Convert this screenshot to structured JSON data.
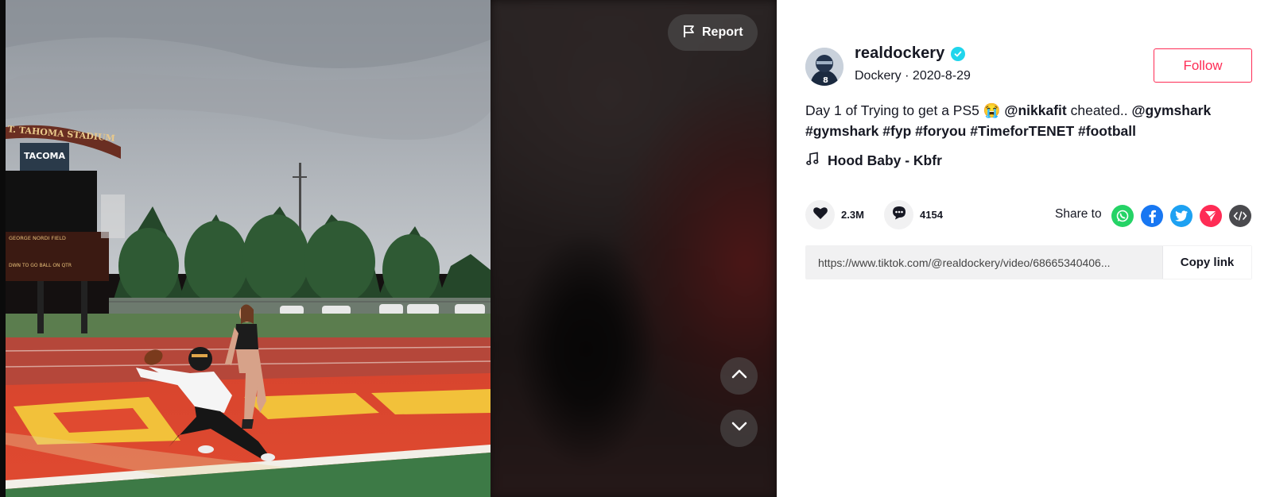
{
  "video": {
    "report_label": "Report",
    "prev_icon": "chevron-up-icon",
    "next_icon": "chevron-down-icon",
    "stadium_sign": "T. TAHOMA STADIUM",
    "scoreboard_logo": "TACOMA",
    "scoreboard_field": "GEORGE NORDI FIELD",
    "scoreboard_row": "DWN  TO GO  BALL ON  QTR"
  },
  "author": {
    "username": "realdockery",
    "verified": true,
    "display_name": "Dockery",
    "separator": "·",
    "date": "2020-8-29",
    "follow_label": "Follow"
  },
  "caption": {
    "parts": [
      {
        "text": "Day 1 of Trying to get a PS5 ",
        "link": false
      },
      {
        "text": "😭",
        "link": false,
        "emoji": true
      },
      {
        "text": " ",
        "link": false
      },
      {
        "text": "@nikkafit",
        "link": true
      },
      {
        "text": " cheated.. ",
        "link": false
      },
      {
        "text": "@gymshark",
        "link": true
      },
      {
        "text": " ",
        "link": false
      },
      {
        "text": "#gymshark",
        "link": true
      },
      {
        "text": " ",
        "link": false
      },
      {
        "text": "#fyp",
        "link": true
      },
      {
        "text": " ",
        "link": false
      },
      {
        "text": "#foryou",
        "link": true
      },
      {
        "text": " ",
        "link": false
      },
      {
        "text": "#TimeforTENET",
        "link": true
      },
      {
        "text": " ",
        "link": false
      },
      {
        "text": "#football",
        "link": true
      }
    ]
  },
  "music": {
    "icon": "music-note-icon",
    "title": "Hood Baby - Kbfr"
  },
  "stats": {
    "likes": "2.3M",
    "comments": "4154"
  },
  "share": {
    "label": "Share to",
    "targets": [
      {
        "name": "whatsapp",
        "color": "#25d366"
      },
      {
        "name": "facebook",
        "color": "#1877f2"
      },
      {
        "name": "twitter",
        "color": "#1da1f2"
      },
      {
        "name": "send",
        "color": "#fe2c55"
      },
      {
        "name": "embed",
        "color": "#4a4a4e"
      }
    ]
  },
  "link": {
    "url": "https://www.tiktok.com/@realdockery/video/68665340406...",
    "copy_label": "Copy link"
  },
  "colors": {
    "accent": "#fe2c55",
    "verified": "#20d5ec",
    "text": "#161823"
  }
}
